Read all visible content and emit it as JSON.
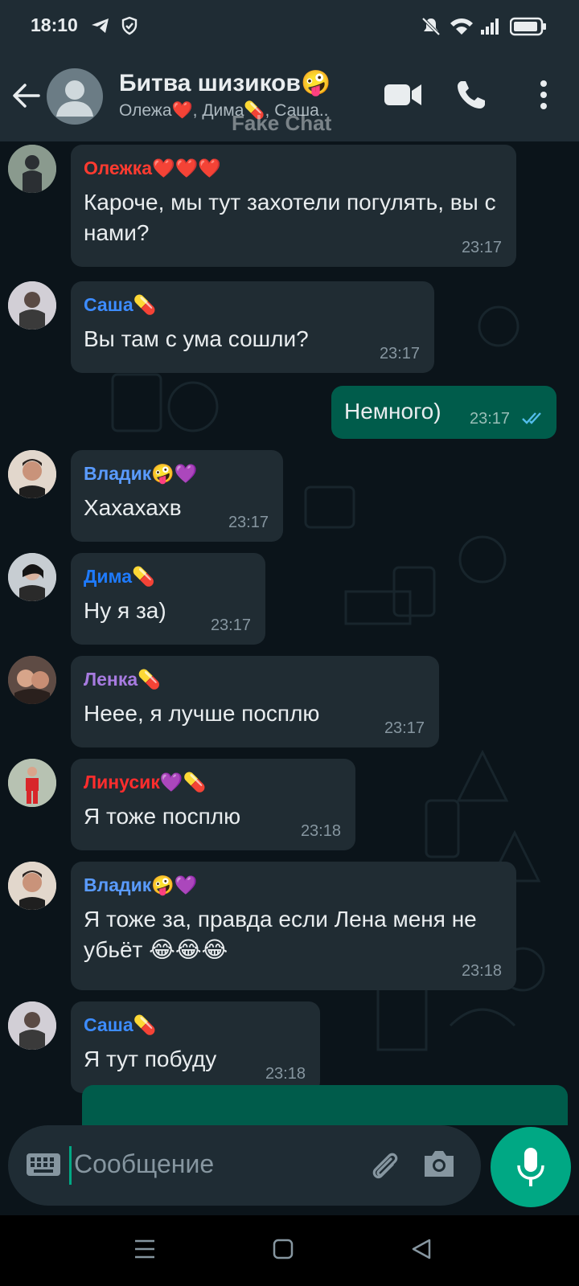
{
  "status_bar": {
    "time": "18:10",
    "icons": [
      "telegram-icon",
      "shield-icon",
      "mute-icon",
      "wifi-icon",
      "signal-icon",
      "battery-icon"
    ]
  },
  "header": {
    "title": "Битва шизиков🤪",
    "subtitle": "Олежа❤️, Дима💊, Саша..",
    "watermark": "Fake Chat",
    "icons": [
      "back-arrow-icon",
      "video-call-icon",
      "phone-call-icon",
      "more-vert-icon"
    ]
  },
  "messages": [
    {
      "sender": "Олежка❤️❤️❤️",
      "sender_color": "#ff3b30",
      "text": "Кароче, мы тут захотели погулять, вы с нами?",
      "time": "23:17"
    },
    {
      "sender": "Саша💊",
      "sender_color": "#3d8cff",
      "text": "Вы там с ума сошли?",
      "time": "23:17"
    },
    {
      "outgoing": true,
      "text": "Немного)",
      "time": "23:17",
      "status": "read"
    },
    {
      "sender": "Владик🤪💜",
      "sender_color": "#5a9bff",
      "text": "Хахахахв",
      "time": "23:17"
    },
    {
      "sender": "Дима💊",
      "sender_color": "#1e7bff",
      "text": "Ну я за)",
      "time": "23:17"
    },
    {
      "sender": "Ленка💊",
      "sender_color": "#a77be0",
      "text": "Неее, я лучше посплю",
      "time": "23:17"
    },
    {
      "sender": "Линусик💜💊",
      "sender_color": "#ff2d2d",
      "text": "Я тоже посплю",
      "time": "23:18"
    },
    {
      "sender": "Владик🤪💜",
      "sender_color": "#5a9bff",
      "text": "Я тоже за, правда если Лена меня не убьёт 😂😂😂",
      "time": "23:18"
    },
    {
      "sender": "Саша💊",
      "sender_color": "#3d8cff",
      "text": "Я тут побуду",
      "time": "23:18"
    }
  ],
  "composer": {
    "placeholder": "Сообщение",
    "icons": [
      "keyboard-icon",
      "attach-icon",
      "camera-icon",
      "mic-icon"
    ]
  },
  "colors": {
    "bg": "#0b141a",
    "bar": "#1f2c34",
    "incoming_bubble": "#202c33",
    "outgoing_bubble": "#005c4b",
    "accent": "#00a884",
    "read_ticks": "#53bdeb"
  }
}
